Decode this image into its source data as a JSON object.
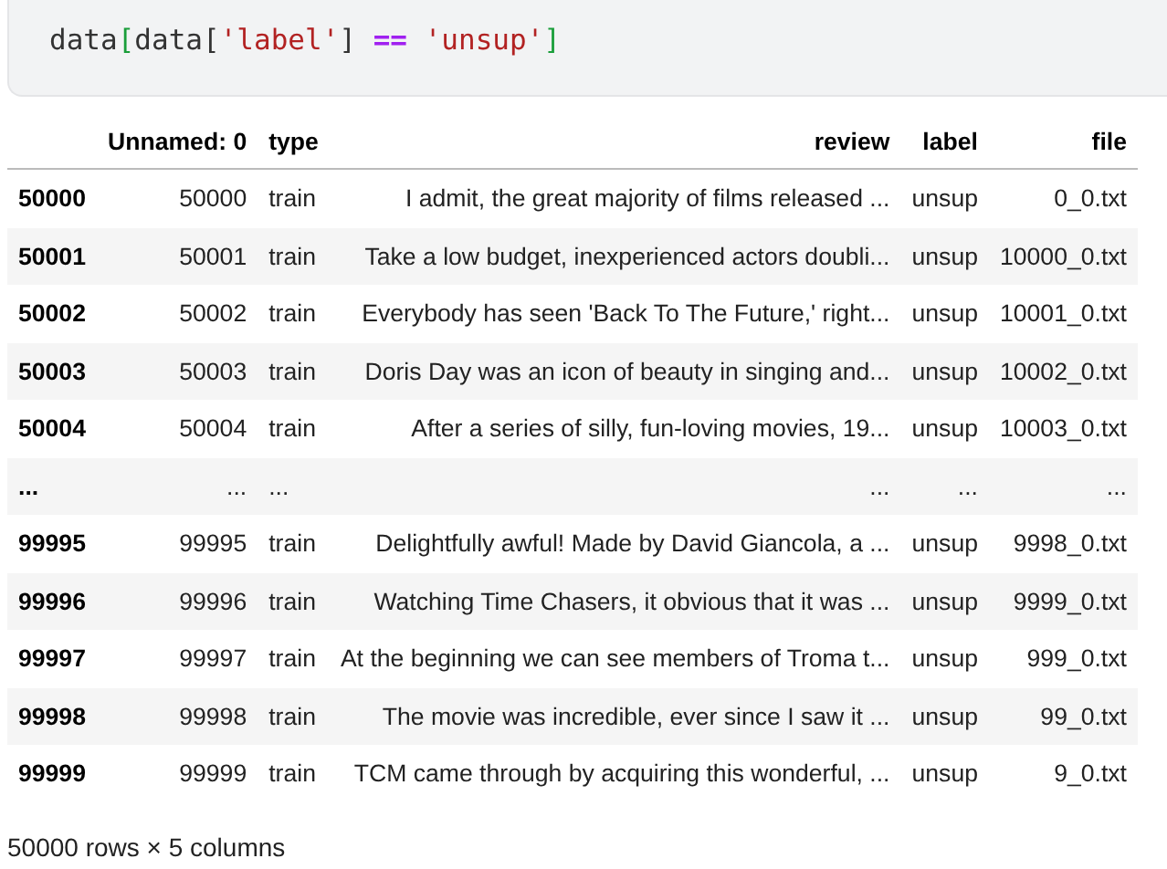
{
  "code_cell": {
    "tokens": [
      {
        "text": "data",
        "kind": "name"
      },
      {
        "text": "[",
        "kind": "bracket"
      },
      {
        "text": "data",
        "kind": "name"
      },
      {
        "text": "[",
        "kind": "punct"
      },
      {
        "text": "'label'",
        "kind": "string"
      },
      {
        "text": "]",
        "kind": "punct"
      },
      {
        "text": "==",
        "kind": "operator"
      },
      {
        "text": "'unsup'",
        "kind": "string"
      },
      {
        "text": "]",
        "kind": "bracket"
      }
    ]
  },
  "table": {
    "columns": [
      "",
      "Unnamed: 0",
      "type",
      "review",
      "label",
      "file"
    ],
    "rows": [
      [
        "50000",
        "50000",
        "train",
        "I admit, the great majority of films released ...",
        "unsup",
        "0_0.txt"
      ],
      [
        "50001",
        "50001",
        "train",
        "Take a low budget, inexperienced actors doubli...",
        "unsup",
        "10000_0.txt"
      ],
      [
        "50002",
        "50002",
        "train",
        "Everybody has seen 'Back To The Future,' right...",
        "unsup",
        "10001_0.txt"
      ],
      [
        "50003",
        "50003",
        "train",
        "Doris Day was an icon of beauty in singing and...",
        "unsup",
        "10002_0.txt"
      ],
      [
        "50004",
        "50004",
        "train",
        "After a series of silly, fun-loving movies, 19...",
        "unsup",
        "10003_0.txt"
      ],
      [
        "...",
        "...",
        "...",
        "...",
        "...",
        "..."
      ],
      [
        "99995",
        "99995",
        "train",
        "Delightfully awful! Made by David Giancola, a ...",
        "unsup",
        "9998_0.txt"
      ],
      [
        "99996",
        "99996",
        "train",
        "Watching Time Chasers, it obvious that it was ...",
        "unsup",
        "9999_0.txt"
      ],
      [
        "99997",
        "99997",
        "train",
        "At the beginning we can see members of Troma t...",
        "unsup",
        "999_0.txt"
      ],
      [
        "99998",
        "99998",
        "train",
        "The movie was incredible, ever since I saw it ...",
        "unsup",
        "99_0.txt"
      ],
      [
        "99999",
        "99999",
        "train",
        "TCM came through by acquiring this wonderful, ...",
        "unsup",
        "9_0.txt"
      ]
    ]
  },
  "footer": "50000 rows × 5 columns"
}
